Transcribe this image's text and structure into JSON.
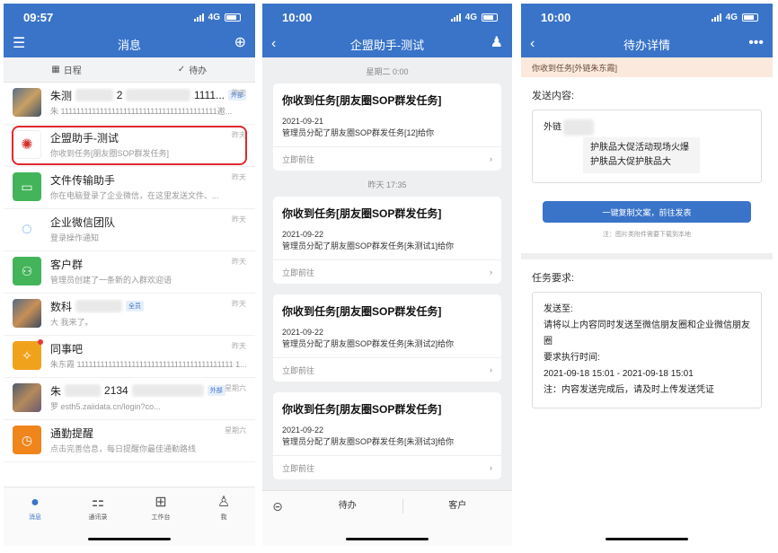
{
  "s1": {
    "time": "09:57",
    "network": "4G",
    "title": "消息",
    "segments": [
      "日程",
      "待办"
    ],
    "chats": [
      {
        "name_pre": "朱测",
        "name_post": "2",
        "name_tail": "1111...",
        "tag": "外部",
        "preview": "朱 1111111111111111111111111111111111111111邀...",
        "time": "昨天",
        "avatar_color": "#7b7f8a"
      },
      {
        "name_pre": "企盟助手-测试",
        "name_post": "",
        "name_tail": "",
        "tag": "",
        "preview": "你收到任务[朋友圈SOP群发任务]",
        "time": "昨天",
        "avatar_color": "#ffffff"
      },
      {
        "name_pre": "文件传输助手",
        "name_post": "",
        "name_tail": "",
        "tag": "",
        "preview": "你在电脑登录了企业微信，在这里发送文件、...",
        "time": "昨天",
        "avatar_color": "#44b45a"
      },
      {
        "name_pre": "企业微信团队",
        "name_post": "",
        "name_tail": "",
        "tag": "",
        "preview": "登录操作通知",
        "time": "昨天",
        "avatar_color": "#ffffff"
      },
      {
        "name_pre": "客户群",
        "name_post": "",
        "name_tail": "",
        "tag": "",
        "preview": "管理员创建了一条新的入群欢迎语",
        "time": "昨天",
        "avatar_color": "#44b45a"
      },
      {
        "name_pre": "数科",
        "name_post": "",
        "name_tail": "",
        "tag": "全员",
        "preview": "大 我来了。",
        "time": "昨天",
        "avatar_color": "#6a7088"
      },
      {
        "name_pre": "同事吧",
        "name_post": "",
        "name_tail": "",
        "tag": "",
        "preview": "朱东霞 1111111111111111111111111111111111111111 1...",
        "time": "昨天",
        "avatar_color": "#f0a21c"
      },
      {
        "name_pre": "朱",
        "name_post": "2134",
        "name_tail": "",
        "tag": "外部",
        "preview": "罗 esth5.zaiidata.cn/login?co...",
        "time": "星期六",
        "avatar_color": "#6f6a78"
      },
      {
        "name_pre": "通勤提醒",
        "name_post": "",
        "name_tail": "",
        "tag": "",
        "preview": "点击完善信息，每日提醒你最佳通勤路线",
        "time": "星期六",
        "avatar_color": "#f0851c"
      }
    ],
    "tabs": [
      "消息",
      "通讯录",
      "工作台",
      "我"
    ]
  },
  "s2": {
    "time": "10:00",
    "network": "4G",
    "title": "企盟助手-测试",
    "timestamps": [
      "星期二 0:00",
      "昨天 17:35"
    ],
    "cards": [
      {
        "title": "你收到任务[朋友圈SOP群发任务]",
        "date": "2021-09-21",
        "desc": "管理员分配了朋友圈SOP群发任务[12]给你",
        "action": "立即前往"
      },
      {
        "title": "你收到任务[朋友圈SOP群发任务]",
        "date": "2021-09-22",
        "desc": "管理员分配了朋友圈SOP群发任务[朱测试1]给你",
        "action": "立即前往"
      },
      {
        "title": "你收到任务[朋友圈SOP群发任务]",
        "date": "2021-09-22",
        "desc": "管理员分配了朋友圈SOP群发任务[朱测试2]给你",
        "action": "立即前往"
      },
      {
        "title": "你收到任务[朋友圈SOP群发任务]",
        "date": "2021-09-22",
        "desc": "管理员分配了朋友圈SOP群发任务[朱测试3]给你",
        "action": "立即前往"
      }
    ],
    "bottom": [
      "待办",
      "客户"
    ]
  },
  "s3": {
    "time": "10:00",
    "network": "4G",
    "title": "待办详情",
    "notice": "你收到任务[外链朱东霞]",
    "send_label": "发送内容:",
    "link_prefix": "外链",
    "content": "护肤品大促活动现场火爆护肤品大促护肤品大",
    "button": "一键复制文案，前往发表",
    "note": "注：图片类附件需要下载到本地",
    "req_label": "任务要求:",
    "req_lines": [
      "发送至:",
      "请将以上内容同时发送至微信朋友圈和企业微信朋友圈",
      "要求执行时间:",
      "2021-09-18 15:01 - 2021-09-18 15:01",
      "注：内容发送完成后，请及时上传发送凭证"
    ]
  }
}
